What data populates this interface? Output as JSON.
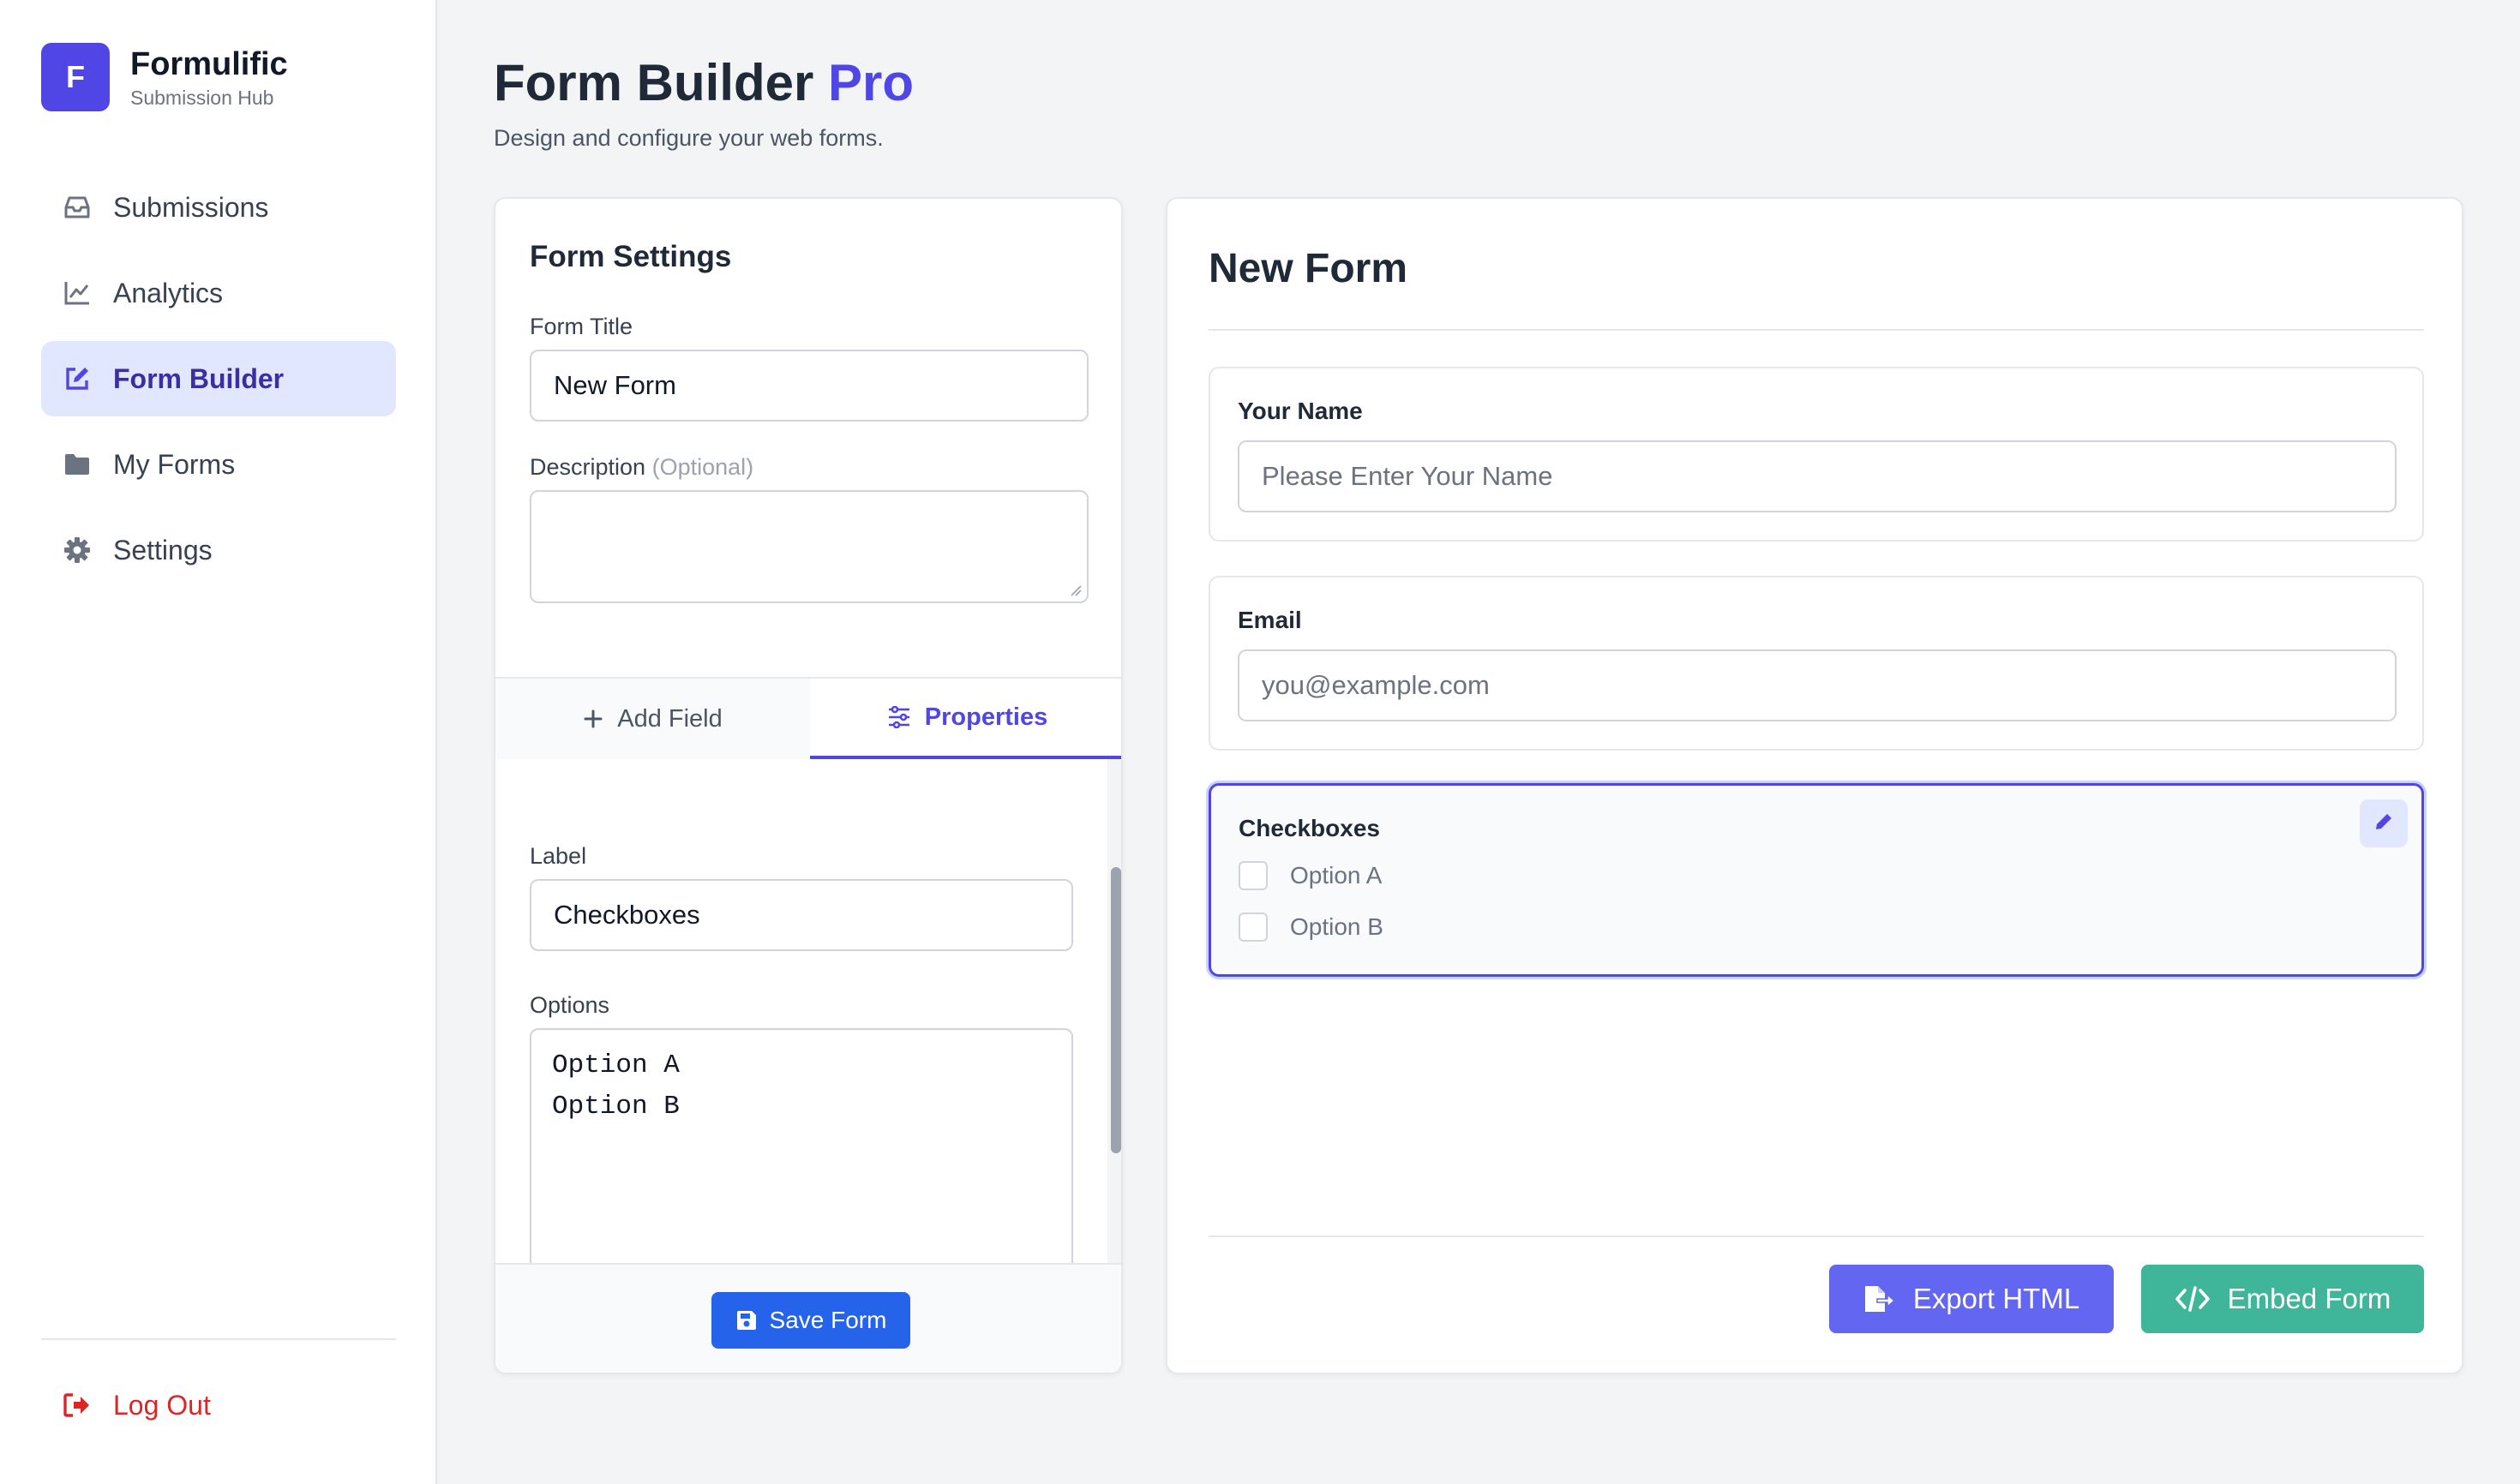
{
  "brand": {
    "logo_letter": "F",
    "name": "Formulific",
    "subtitle": "Submission Hub"
  },
  "nav": {
    "items": [
      {
        "label": "Submissions",
        "icon": "inbox-icon"
      },
      {
        "label": "Analytics",
        "icon": "line-chart-icon"
      },
      {
        "label": "Form Builder",
        "icon": "edit-icon",
        "active": true
      },
      {
        "label": "My Forms",
        "icon": "folder-icon"
      },
      {
        "label": "Settings",
        "icon": "gear-icon"
      }
    ],
    "logout_label": "Log Out"
  },
  "header": {
    "title": "Form Builder",
    "title_accent": "Pro",
    "subtitle": "Design and configure your web forms."
  },
  "settings": {
    "title": "Form Settings",
    "form_title_label": "Form Title",
    "form_title_value": "New Form",
    "description_label": "Description",
    "description_optional": "(Optional)",
    "description_value": "",
    "tabs": [
      {
        "label": "Add Field",
        "icon": "plus-icon"
      },
      {
        "label": "Properties",
        "icon": "sliders-icon",
        "active": true
      }
    ],
    "properties": {
      "label_label": "Label",
      "label_value": "Checkboxes",
      "options_label": "Options",
      "options_value": "Option A\nOption B"
    },
    "save_label": "Save Form"
  },
  "preview": {
    "form_title": "New Form",
    "fields": [
      {
        "label": "Your Name",
        "type": "text",
        "placeholder": "Please Enter Your Name"
      },
      {
        "label": "Email",
        "type": "email",
        "placeholder": "you@example.com"
      },
      {
        "label": "Checkboxes",
        "type": "checkbox",
        "options": [
          "Option A",
          "Option B"
        ],
        "selected": true
      }
    ],
    "export_label": "Export HTML",
    "embed_label": "Embed Form"
  },
  "colors": {
    "accent": "#4f46e5",
    "save_button": "#2563eb",
    "export_button": "#6366f1",
    "embed_button": "#3fb59a",
    "logout": "#dc2626"
  }
}
